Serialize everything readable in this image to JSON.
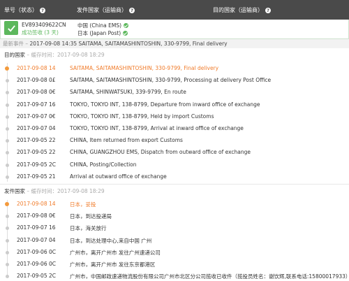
{
  "header": {
    "col_number": "单号（状态）",
    "col_origin": "发件国家（运输商）",
    "col_dest": "目的国家（运输商）"
  },
  "package": {
    "tracking_no": "EV893409622CN",
    "status": "成功签收 (3 天)",
    "origin": "中国 (China EMS)",
    "dest": "日本 (Japan Post)"
  },
  "latest": {
    "label": "最新事件",
    "time": "2017-09-08 14:35",
    "text": "SAITAMA, SAITAMASHINTOSHIN, 330-9799, Final delivery"
  },
  "dest_section": {
    "label": "目的国家",
    "cache_label": "缓存时间：",
    "cache_time": "2017-09-08 18:29"
  },
  "dest_events": [
    {
      "date": "2017-09-08 14",
      "text": "SAITAMA, SAITAMASHINTOSHIN, 330-9799, Final delivery"
    },
    {
      "date": "2017-09-08 0£",
      "text": "SAITAMA, SAITAMASHINTOSHIN, 330-9799, Processing at delivery Post Office"
    },
    {
      "date": "2017-09-08 0€",
      "text": "SAITAMA, SHINWATSUKI, 339-9799, En route"
    },
    {
      "date": "2017-09-07 16",
      "text": "TOKYO, TOKYO INT, 138-8799, Departure from inward office of exchange"
    },
    {
      "date": "2017-09-07 0€",
      "text": "TOKYO, TOKYO INT, 138-8799, Held by import Customs"
    },
    {
      "date": "2017-09-07 04",
      "text": "TOKYO, TOKYO INT, 138-8799, Arrival at inward office of exchange"
    },
    {
      "date": "2017-09-05 22",
      "text": "CHINA, Item returned from export Customs"
    },
    {
      "date": "2017-09-05 22",
      "text": "CHINA, GUANGZHOU EMS, Dispatch from outward office of exchange"
    },
    {
      "date": "2017-09-05 2C",
      "text": "CHINA, Posting/Collection"
    },
    {
      "date": "2017-09-05 21",
      "text": "Arrival at outward office of exchange"
    }
  ],
  "origin_section": {
    "label": "发件国家",
    "cache_label": "缓存时间：",
    "cache_time": "2017-09-08 18:29"
  },
  "origin_events": [
    {
      "date": "2017-09-08 14",
      "text": "日本，妥投"
    },
    {
      "date": "2017-09-08 0€",
      "text": "日本，到达投递局"
    },
    {
      "date": "2017-09-07 16",
      "text": "日本，海关放行"
    },
    {
      "date": "2017-09-07 04",
      "text": "日本，到达处理中心,来自中国 广州"
    },
    {
      "date": "2017-09-06 0C",
      "text": "广州市，离开广州市 发往广州速递公司"
    },
    {
      "date": "2017-09-06 0C",
      "text": "广州市，离开广州市 发往东京都港区"
    },
    {
      "date": "2017-09-05 2C",
      "text": "广州市，中国邮政速递物流股份有限公司广州市北区分公司揽收已收件（揽投员姓名：谢饮辉,联系电话:15800017933）"
    }
  ],
  "colors": {
    "header": "#4a4a4a",
    "success": "#5cb85c",
    "highlight": "#f07b2a"
  }
}
